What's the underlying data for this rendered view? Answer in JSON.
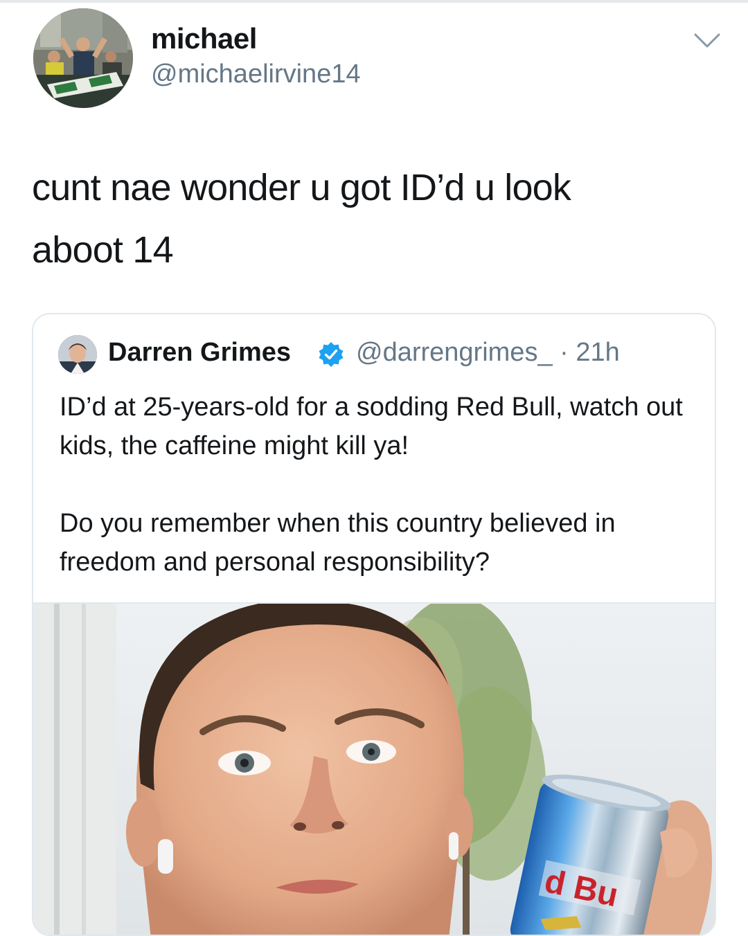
{
  "tweet": {
    "display_name": "michael",
    "handle": "@michaelirvine14",
    "text_line1": "cunt nae wonder u got ID’d u look",
    "text_line2": "aboot 14",
    "menu_icon": "chevron-down-icon"
  },
  "quoted_tweet": {
    "display_name": "Darren Grimes",
    "verified_icon": "verified-badge-icon",
    "handle": "@darrengrimes_",
    "separator": "·",
    "time": "21h",
    "paragraph1": "ID’d at 25-years-old for a sodding Red Bull, watch out kids, the caffeine might kill ya!",
    "paragraph2": "Do you remember when this country believed in freedom and personal responsibility?",
    "photo_can_text": "d Bu"
  },
  "colors": {
    "text_primary": "#14171a",
    "text_secondary": "#657786",
    "border": "#e1e8ed",
    "verified_blue": "#1da1f2"
  }
}
